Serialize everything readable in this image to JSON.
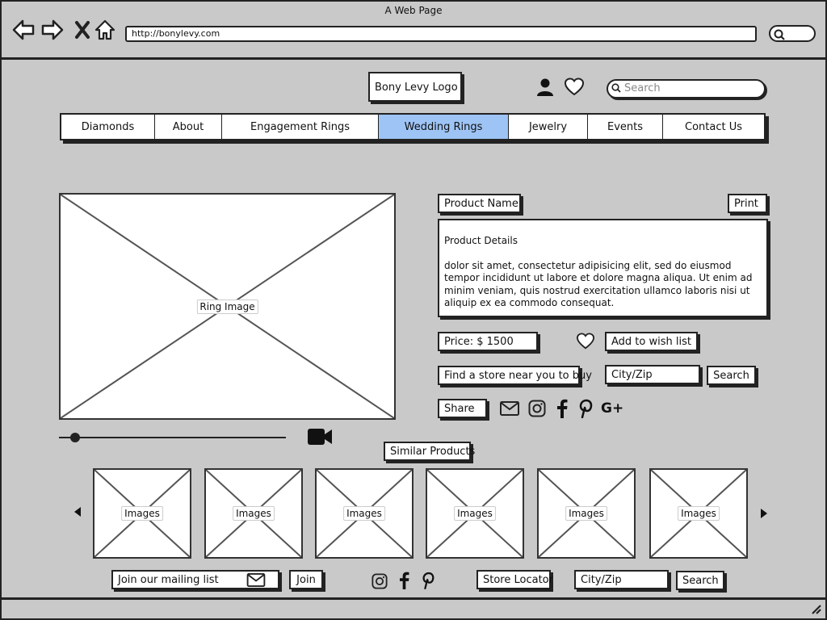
{
  "browser": {
    "title": "A Web Page",
    "url": "http://bonylevy.com"
  },
  "header": {
    "logo": "Bony Levy Logo",
    "search_placeholder": "Search"
  },
  "nav": {
    "items": [
      {
        "label": "Diamonds"
      },
      {
        "label": "About"
      },
      {
        "label": "Engagement Rings"
      },
      {
        "label": "Wedding Rings",
        "active": true
      },
      {
        "label": "Jewelry"
      },
      {
        "label": "Events"
      },
      {
        "label": "Contact Us"
      }
    ]
  },
  "product": {
    "image_label": "Ring Image",
    "name": "Product Name",
    "print": "Print",
    "details_title": "Product Details",
    "details_text": " dolor sit amet, consectetur adipisicing elit, sed do eiusmod tempor incididunt ut labore et dolore magna aliqua. Ut enim ad minim veniam, quis nostrud exercitation ullamco laboris nisi ut aliquip ex ea commodo consequat.",
    "price": "Price: $ 1500",
    "wishlist": "Add to wish list",
    "find_store": "Find a store near you to buy",
    "city_zip": "City/Zip",
    "search": "Search",
    "share": "Share"
  },
  "similar": {
    "title": "Similar Products",
    "items": [
      "Images",
      "Images",
      "Images",
      "Images",
      "Images",
      "Images"
    ]
  },
  "footer": {
    "mailing_list": "Join our mailing list",
    "join": "Join",
    "store_locator": "Store Locator",
    "city_zip": "City/Zip",
    "search": "Search"
  },
  "colors": {
    "background": "#c9c9c9",
    "active_tab": "#9ec4f5"
  }
}
